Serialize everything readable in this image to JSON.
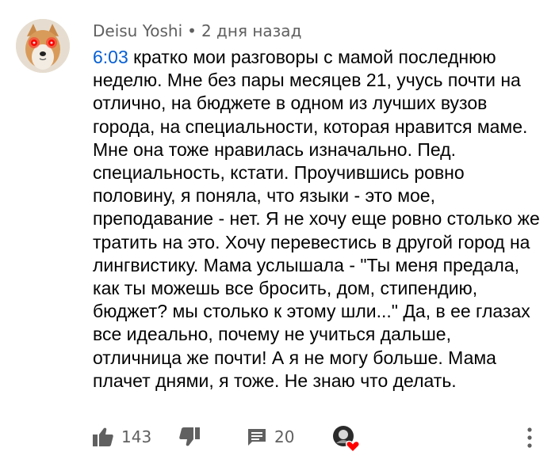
{
  "comment": {
    "author": "Deisu Yoshi",
    "separator": "•",
    "time_ago": "2 дня назад",
    "timestamp_link": "6:03",
    "text": " кратко мои разговоры с мамой последнюю неделю. Мне без пары месяцев 21, учусь почти на отлично, на бюджете в одном из лучших вузов города, на специальности, которая нравится маме. Мне она тоже нравилась изначально. Пед. специальность, кстати. Проучившись ровно половину, я поняла, что языки - это мое, преподавание - нет. Я не хочу еще ровно столько же тратить на это. Хочу перевестись в другой город на лингвистику. Мама услышала - \"Ты меня предала, как ты можешь все бросить, дом, стипендию, бюджет? мы столько к этому шли...\" Да, в ее глазах все идеально, почему не учиться дальше, отличница же почти! А я не могу больше. Мама плачет днями, я тоже. Не знаю что делать."
  },
  "actions": {
    "like_count": "143",
    "reply_count": "20"
  },
  "icons": {
    "avatar": "dog-avatar-icon",
    "like": "thumbs-up-icon",
    "dislike": "thumbs-down-icon",
    "reply": "comment-icon",
    "creator_heart": "creator-heart-icon",
    "menu": "more-vertical-icon"
  },
  "colors": {
    "link": "#065fd4",
    "meta_text": "#606060",
    "icon": "#606060",
    "heart": "#ff0000"
  }
}
